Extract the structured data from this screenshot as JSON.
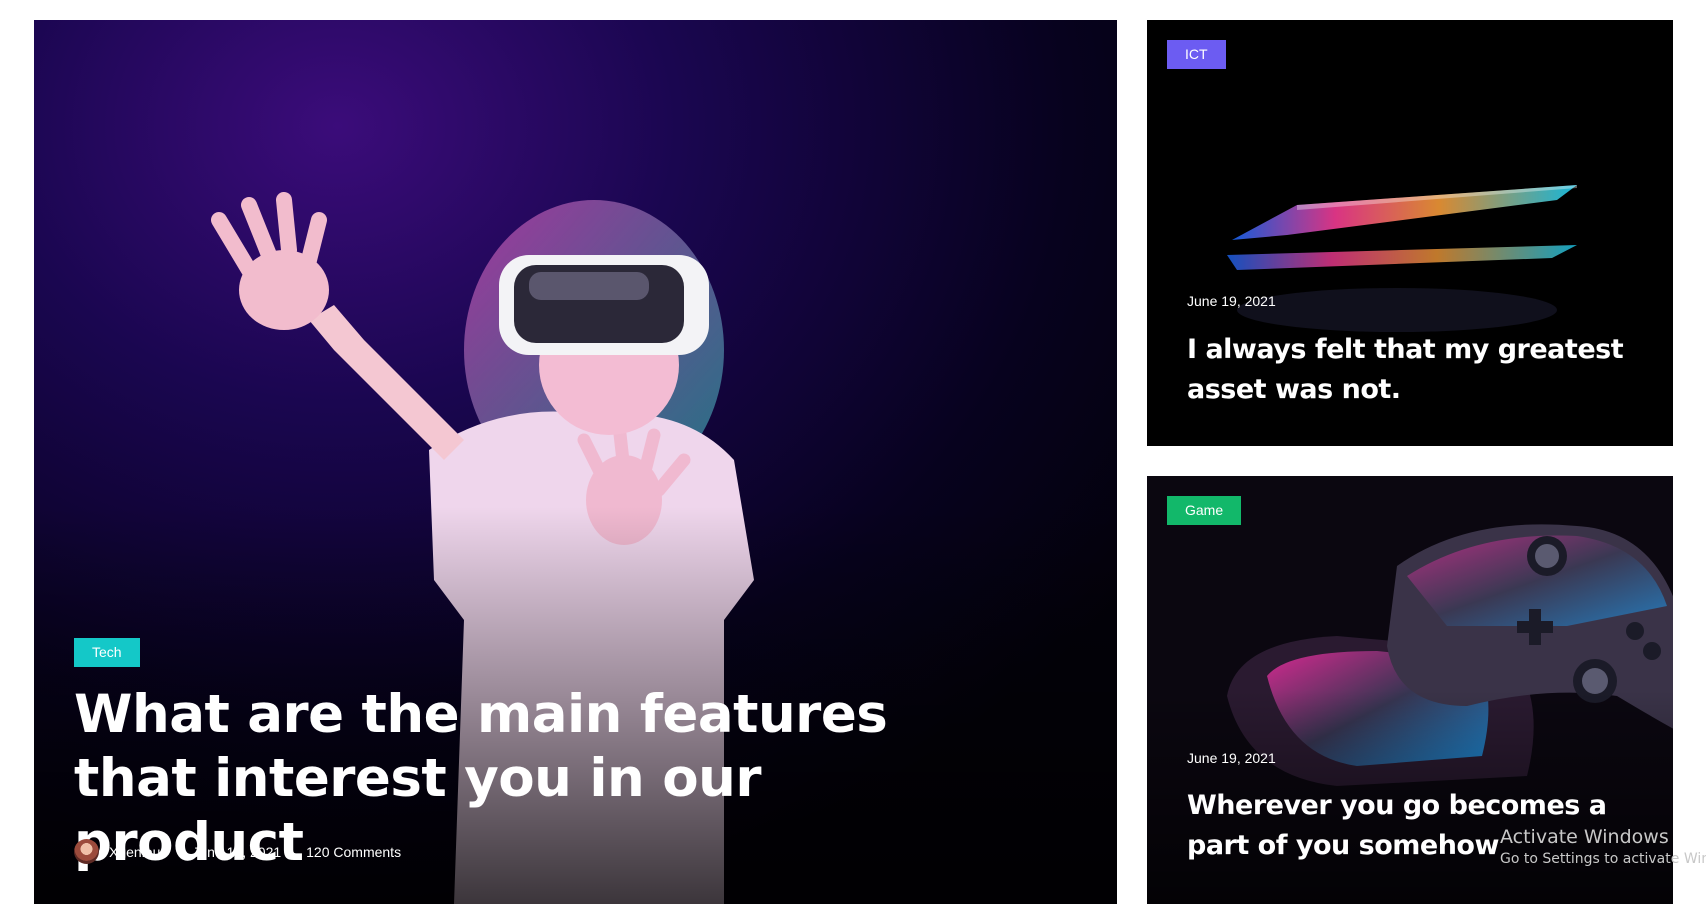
{
  "featured": {
    "category": "Tech",
    "category_color": "#14c8c8",
    "title": "What are the main features that interest you in our product",
    "author": "Xgenious",
    "date": "June 19, 2021",
    "comments": "120 Comments"
  },
  "side_posts": [
    {
      "category": "ICT",
      "category_color": "#6c5cf2",
      "date": "June 19, 2021",
      "title": "I always felt that my greatest asset was not."
    },
    {
      "category": "Game",
      "category_color": "#12b86a",
      "date": "June 19, 2021",
      "title": "Wherever you go becomes a part of you somehow"
    }
  ],
  "watermark": {
    "line1": "Activate Windows",
    "line2": "Go to Settings to activate Windows."
  }
}
